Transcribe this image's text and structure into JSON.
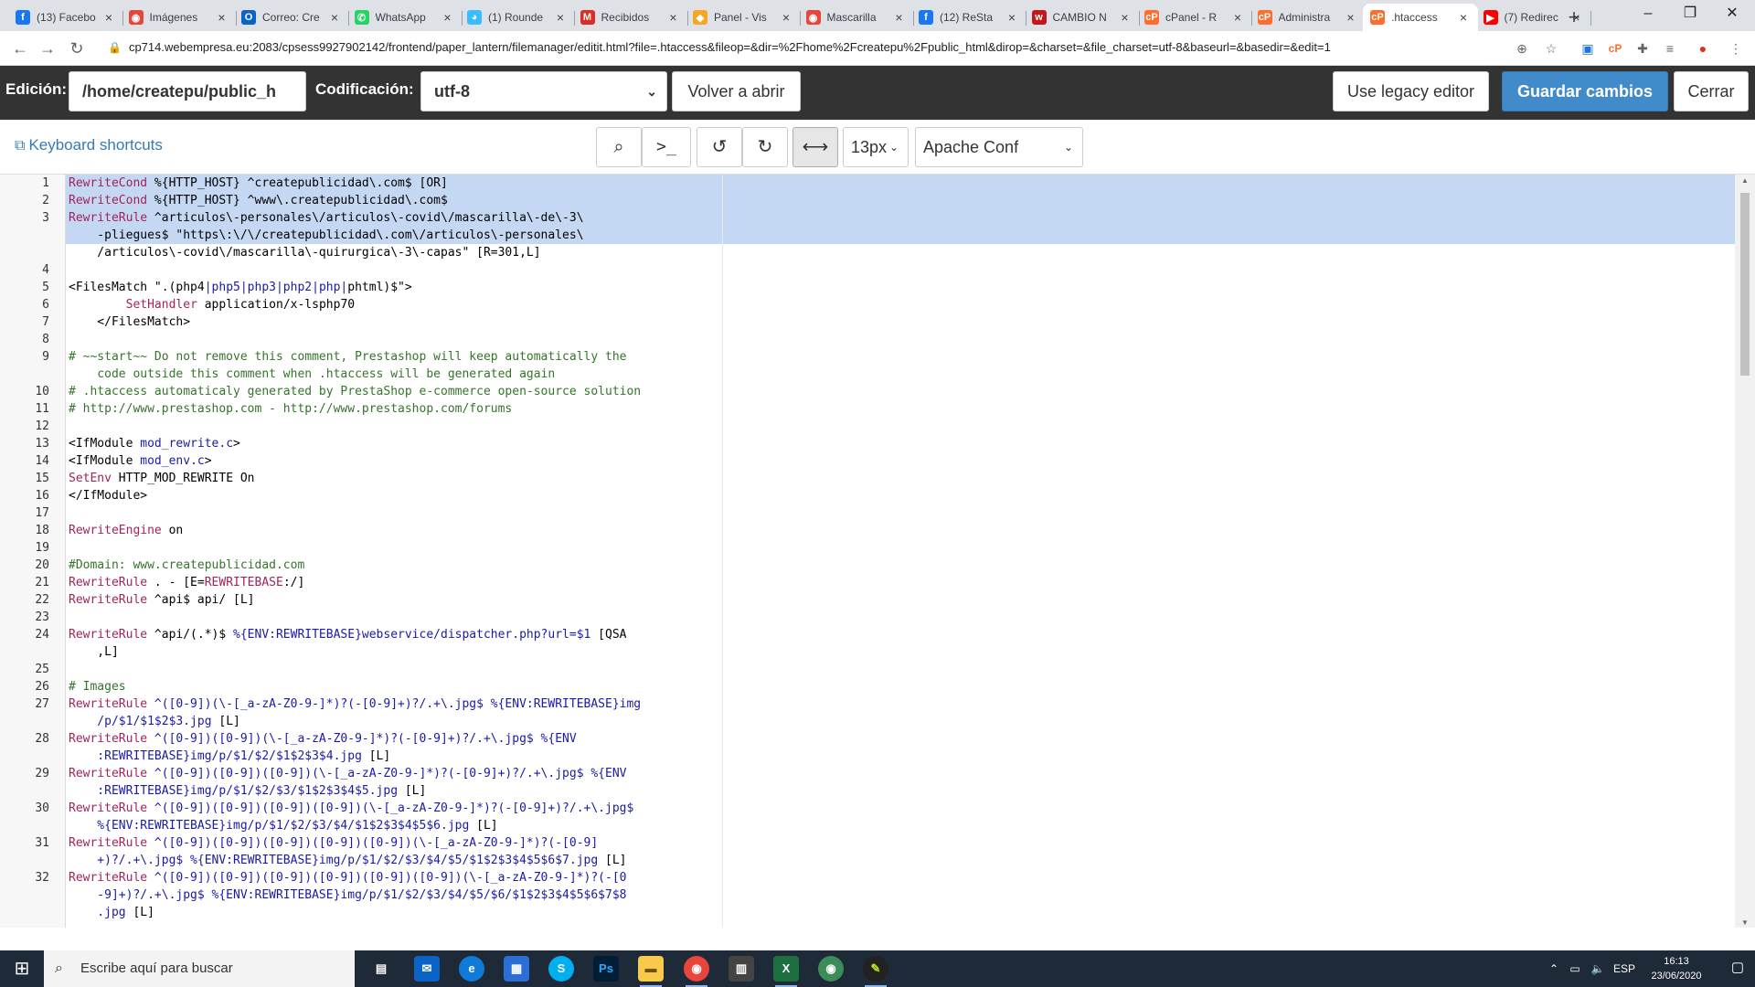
{
  "browser": {
    "tabs": [
      {
        "title": "(13) Facebo",
        "icon": "facebook-icon",
        "color": "#1877f2",
        "glyph": "f"
      },
      {
        "title": "Imágenes",
        "icon": "chrome-icon",
        "color": "#e8453c",
        "glyph": "◉"
      },
      {
        "title": "Correo: Cre",
        "icon": "outlook-icon",
        "color": "#0a64c8",
        "glyph": "O"
      },
      {
        "title": "WhatsApp",
        "icon": "whatsapp-icon",
        "color": "#25d366",
        "glyph": "✆"
      },
      {
        "title": "(1) Rounde",
        "icon": "roundcube-icon",
        "color": "#37beff",
        "glyph": "◕"
      },
      {
        "title": "Recibidos",
        "icon": "gmail-icon",
        "color": "#d93025",
        "glyph": "M"
      },
      {
        "title": "Panel - Vis",
        "icon": "diamond-icon",
        "color": "#f5a623",
        "glyph": "◆"
      },
      {
        "title": "Mascarilla",
        "icon": "chrome-icon",
        "color": "#e8453c",
        "glyph": "◉"
      },
      {
        "title": "(12) ReSta",
        "icon": "facebook-icon",
        "color": "#1877f2",
        "glyph": "f"
      },
      {
        "title": "CAMBIO N",
        "icon": "webempresa-icon",
        "color": "#c4161c",
        "glyph": "w"
      },
      {
        "title": "cPanel - R",
        "icon": "cpanel-icon",
        "color": "#ff6c2c",
        "glyph": "cP"
      },
      {
        "title": "Administra",
        "icon": "cpanel-icon",
        "color": "#ff6c2c",
        "glyph": "cP"
      },
      {
        "title": ".htaccess",
        "icon": "cpanel-icon",
        "color": "#ff6c2c",
        "glyph": "cP"
      },
      {
        "title": "(7) Redirec",
        "icon": "youtube-icon",
        "color": "#ff0000",
        "glyph": "▶"
      }
    ],
    "active_tab": 12,
    "url": "cp714.webempresa.eu:2083/cpsess9927902142/frontend/paper_lantern/filemanager/editit.html?file=.htaccess&fileop=&dir=%2Fhome%2Fcreatepu%2Fpublic_html&dirop=&charset=&file_charset=utf-8&baseurl=&basedir=&edit=1"
  },
  "header": {
    "edition_label": "Edición:",
    "path_value": "/home/createpu/public_h",
    "encoding_label": "Codificación:",
    "encoding_value": "utf-8",
    "reopen_label": "Volver a abrir",
    "legacy_label": "Use legacy editor",
    "save_label": "Guardar cambios",
    "close_label": "Cerrar"
  },
  "toolbar": {
    "shortcuts_label": "Keyboard shortcuts",
    "font_size": "13px",
    "mode": "Apache Conf"
  },
  "lines": [
    {
      "n": "1",
      "parts": [
        [
          "kw",
          "RewriteCond"
        ],
        [
          "var",
          " %{HTTP_HOST} ^createpublicidad\\.com$ [OR]"
        ]
      ]
    },
    {
      "n": "2",
      "parts": [
        [
          "kw",
          "RewriteCond"
        ],
        [
          "var",
          " %{HTTP_HOST} ^www\\.createpublicidad\\.com$"
        ]
      ]
    },
    {
      "n": "3",
      "parts": [
        [
          "kw",
          "RewriteRule"
        ],
        [
          "var",
          " ^articulos\\-personales\\/articulos\\-covid\\/mascarilla\\-de\\-3\\"
        ]
      ]
    },
    {
      "n": "",
      "parts": [
        [
          "var",
          "    -pliegues$ \"https\\:\\/\\/createpublicidad\\.com\\/articulos\\-personales\\"
        ]
      ]
    },
    {
      "n": "",
      "parts": [
        [
          "var",
          "    /articulos\\-covid\\/mascarilla\\-quirurgica\\-3\\-capas\" [R=301,L]"
        ]
      ]
    },
    {
      "n": "4",
      "parts": []
    },
    {
      "n": "5",
      "parts": [
        [
          "tag",
          "<FilesMatch \".(php4"
        ],
        [
          "str",
          "|php5|php3|php2|php|"
        ],
        [
          "tag",
          "phtml)$\">"
        ]
      ]
    },
    {
      "n": "6",
      "parts": [
        [
          "var",
          "        "
        ],
        [
          "kw",
          "SetHandler"
        ],
        [
          "var",
          " application/x-lsphp70"
        ]
      ]
    },
    {
      "n": "7",
      "parts": [
        [
          "tag",
          "    </FilesMatch>"
        ]
      ]
    },
    {
      "n": "8",
      "parts": []
    },
    {
      "n": "9",
      "parts": [
        [
          "cm",
          "# ~~start~~ Do not remove this comment, Prestashop will keep automatically the"
        ]
      ]
    },
    {
      "n": "",
      "parts": [
        [
          "cm",
          "    code outside this comment when .htaccess will be generated again"
        ]
      ]
    },
    {
      "n": "10",
      "parts": [
        [
          "cm",
          "# .htaccess automaticaly generated by PrestaShop e-commerce open-source solution"
        ]
      ]
    },
    {
      "n": "11",
      "parts": [
        [
          "cm",
          "# http://www.prestashop.com - http://www.prestashop.com/forums"
        ]
      ]
    },
    {
      "n": "12",
      "parts": []
    },
    {
      "n": "13",
      "parts": [
        [
          "tag",
          "<IfModule "
        ],
        [
          "at",
          "mod_rewrite.c"
        ],
        [
          "tag",
          ">"
        ]
      ]
    },
    {
      "n": "14",
      "parts": [
        [
          "tag",
          "<IfModule "
        ],
        [
          "at",
          "mod_env.c"
        ],
        [
          "tag",
          ">"
        ]
      ]
    },
    {
      "n": "15",
      "parts": [
        [
          "kw",
          "SetEnv"
        ],
        [
          "var",
          " HTTP_MOD_REWRITE On"
        ]
      ]
    },
    {
      "n": "16",
      "parts": [
        [
          "tag",
          "</IfModule>"
        ]
      ]
    },
    {
      "n": "17",
      "parts": []
    },
    {
      "n": "18",
      "parts": [
        [
          "kw",
          "RewriteEngine"
        ],
        [
          "var",
          " on"
        ]
      ]
    },
    {
      "n": "19",
      "parts": []
    },
    {
      "n": "20",
      "parts": [
        [
          "cm",
          "#Domain: www.createpublicidad.com"
        ]
      ]
    },
    {
      "n": "21",
      "parts": [
        [
          "kw",
          "RewriteRule"
        ],
        [
          "var",
          " . - [E="
        ],
        [
          "kw",
          "REWRITEBASE"
        ],
        [
          "var",
          ":/]"
        ]
      ]
    },
    {
      "n": "22",
      "parts": [
        [
          "kw",
          "RewriteRule"
        ],
        [
          "var",
          " ^api$ api/ [L]"
        ]
      ]
    },
    {
      "n": "23",
      "parts": []
    },
    {
      "n": "24",
      "parts": [
        [
          "kw",
          "RewriteRule"
        ],
        [
          "var",
          " ^api/(.*)$ "
        ],
        [
          "str",
          "%{ENV:REWRITEBASE}webservice/dispatcher.php?url=$1"
        ],
        [
          "var",
          " [QSA"
        ]
      ]
    },
    {
      "n": "",
      "parts": [
        [
          "var",
          "    ,L]"
        ]
      ]
    },
    {
      "n": "25",
      "parts": []
    },
    {
      "n": "26",
      "parts": [
        [
          "cm",
          "# Images"
        ]
      ]
    },
    {
      "n": "27",
      "parts": [
        [
          "kw",
          "RewriteRule"
        ],
        [
          "str",
          " ^([0-9])(\\-[_a-zA-Z0-9-]*)?(-[0-9]+)?/.+\\.jpg$ %{ENV:REWRITEBASE}img"
        ]
      ]
    },
    {
      "n": "",
      "parts": [
        [
          "str",
          "    /p/$1/$1$2$3.jpg"
        ],
        [
          "var",
          " [L]"
        ]
      ]
    },
    {
      "n": "28",
      "parts": [
        [
          "kw",
          "RewriteRule"
        ],
        [
          "str",
          " ^([0-9])([0-9])(\\-[_a-zA-Z0-9-]*)?(-[0-9]+)?/.+\\.jpg$ %{ENV"
        ]
      ]
    },
    {
      "n": "",
      "parts": [
        [
          "str",
          "    :REWRITEBASE}img/p/$1/$2/$1$2$3$4.jpg"
        ],
        [
          "var",
          " [L]"
        ]
      ]
    },
    {
      "n": "29",
      "parts": [
        [
          "kw",
          "RewriteRule"
        ],
        [
          "str",
          " ^([0-9])([0-9])([0-9])(\\-[_a-zA-Z0-9-]*)?(-[0-9]+)?/.+\\.jpg$ %{ENV"
        ]
      ]
    },
    {
      "n": "",
      "parts": [
        [
          "str",
          "    :REWRITEBASE}img/p/$1/$2/$3/$1$2$3$4$5.jpg"
        ],
        [
          "var",
          " [L]"
        ]
      ]
    },
    {
      "n": "30",
      "parts": [
        [
          "kw",
          "RewriteRule"
        ],
        [
          "str",
          " ^([0-9])([0-9])([0-9])([0-9])(\\-[_a-zA-Z0-9-]*)?(-[0-9]+)?/.+\\.jpg$"
        ]
      ]
    },
    {
      "n": "",
      "parts": [
        [
          "str",
          "    %{ENV:REWRITEBASE}img/p/$1/$2/$3/$4/$1$2$3$4$5$6.jpg"
        ],
        [
          "var",
          " [L]"
        ]
      ]
    },
    {
      "n": "31",
      "parts": [
        [
          "kw",
          "RewriteRule"
        ],
        [
          "str",
          " ^([0-9])([0-9])([0-9])([0-9])([0-9])(\\-[_a-zA-Z0-9-]*)?(-[0-9]"
        ]
      ]
    },
    {
      "n": "",
      "parts": [
        [
          "str",
          "    +)?/.+\\.jpg$ %{ENV:REWRITEBASE}img/p/$1/$2/$3/$4/$5/$1$2$3$4$5$6$7.jpg"
        ],
        [
          "var",
          " [L]"
        ]
      ]
    },
    {
      "n": "32",
      "parts": [
        [
          "kw",
          "RewriteRule"
        ],
        [
          "str",
          " ^([0-9])([0-9])([0-9])([0-9])([0-9])([0-9])(\\-[_a-zA-Z0-9-]*)?(-[0"
        ]
      ]
    },
    {
      "n": "",
      "parts": [
        [
          "str",
          "    -9]+)?/.+\\.jpg$ %{ENV:REWRITEBASE}img/p/$1/$2/$3/$4/$5/$6/$1$2$3$4$5$6$7$8"
        ]
      ]
    },
    {
      "n": "",
      "parts": [
        [
          "str",
          "    .jpg"
        ],
        [
          "var",
          " [L]"
        ]
      ]
    }
  ],
  "taskbar": {
    "search_placeholder": "Escribe aquí para buscar",
    "language": "ESP",
    "time": "16:13",
    "date": "23/06/2020"
  }
}
